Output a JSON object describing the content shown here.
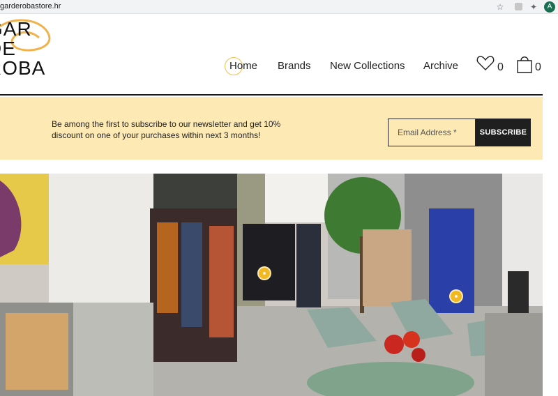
{
  "browser": {
    "url": "garderobastore.hr",
    "profile_initial": "A"
  },
  "header": {
    "logo_lines": [
      "GAR",
      "DE",
      "ROBA"
    ],
    "nav": [
      {
        "label": "Home"
      },
      {
        "label": "Brands"
      },
      {
        "label": "New Collections"
      },
      {
        "label": "Archive"
      }
    ],
    "wishlist_count": "0",
    "cart_count": "0",
    "accent_color": "#f2c14e"
  },
  "newsletter": {
    "text": "Be among the first to subscribe to our newsletter and get 10% discount on one of your purchases within next 3 months!",
    "email_placeholder": "Email Address *",
    "button_label": "SUBSCRIBE",
    "background": "#fce9b4"
  },
  "hero": {
    "description_icons": [
      "store-interior-photo"
    ],
    "hotspot_color": "#f2b821"
  }
}
